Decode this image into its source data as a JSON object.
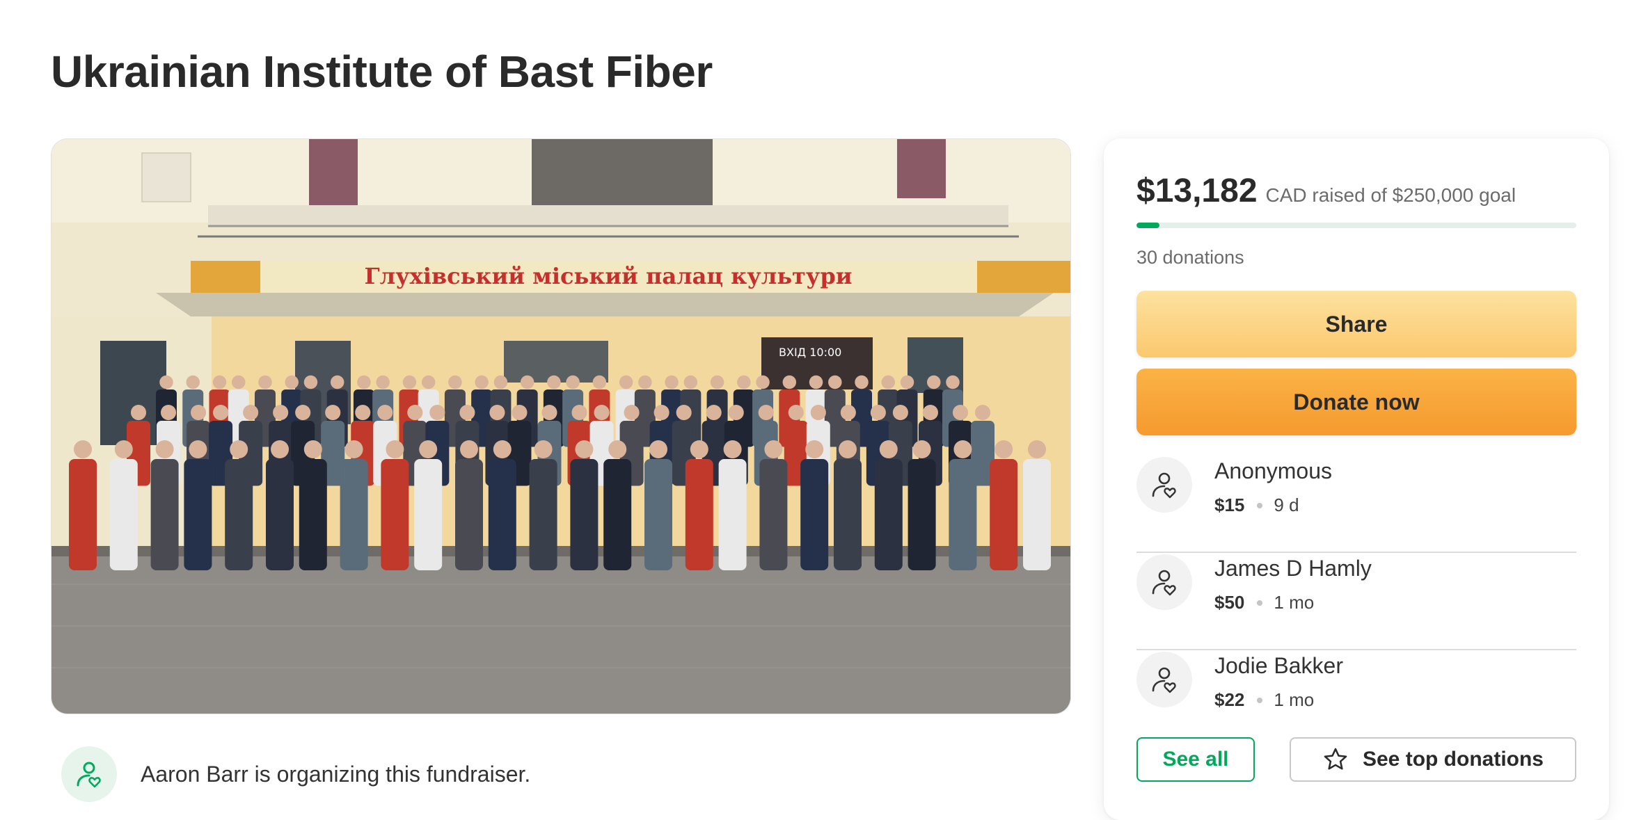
{
  "page": {
    "title": "Ukrainian Institute of Bast Fiber"
  },
  "hero": {
    "banner_text": "Глухівський міський палац культури",
    "sign_text": "ВХІД 10:00"
  },
  "organizer": {
    "text": "Aaron Barr is organizing this fundraiser.",
    "icon": "person-heart-icon"
  },
  "donation_panel": {
    "amount_raised": "$13,182",
    "goal_text": "CAD raised of $250,000 goal",
    "progress_fraction": 0.0527,
    "donations_count": "30 donations",
    "share_label": "Share",
    "donate_label": "Donate now",
    "donors": [
      {
        "name": "Anonymous",
        "amount": "$15",
        "time": "9 d",
        "icon": "person-heart-icon"
      },
      {
        "name": "James D Hamly",
        "amount": "$50",
        "time": "1 mo",
        "icon": "person-heart-icon"
      },
      {
        "name": "Jodie Bakker",
        "amount": "$22",
        "time": "1 mo",
        "icon": "person-heart-icon"
      }
    ],
    "see_all_label": "See all",
    "see_top_label": "See top donations",
    "see_top_icon": "star-icon"
  },
  "colors": {
    "accent_green": "#02a95c",
    "share_button": "#fcd486",
    "donate_button": "#f7a23a"
  }
}
